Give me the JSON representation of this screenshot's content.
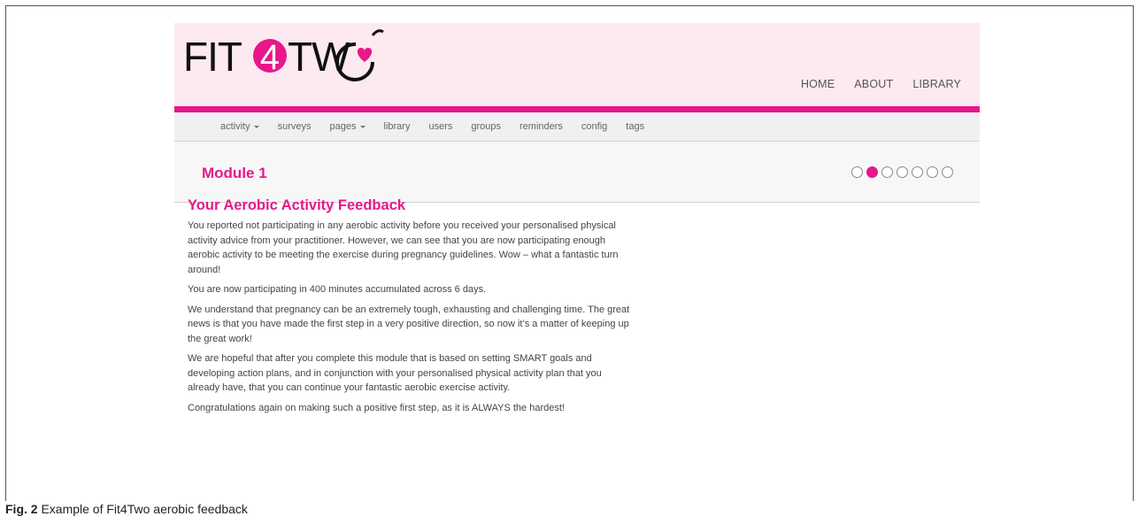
{
  "brand": {
    "logo_text": "FIT4TWO",
    "accent_color": "#e8178a"
  },
  "top_nav": [
    "HOME",
    "ABOUT",
    "LIBRARY"
  ],
  "admin_nav": [
    {
      "label": "activity",
      "dropdown": true
    },
    {
      "label": "surveys",
      "dropdown": false
    },
    {
      "label": "pages",
      "dropdown": true
    },
    {
      "label": "library",
      "dropdown": false
    },
    {
      "label": "users",
      "dropdown": false
    },
    {
      "label": "groups",
      "dropdown": false
    },
    {
      "label": "reminders",
      "dropdown": false
    },
    {
      "label": "config",
      "dropdown": false
    },
    {
      "label": "tags",
      "dropdown": false
    }
  ],
  "module": {
    "title": "Module 1",
    "progress": {
      "total": 7,
      "current": 2
    }
  },
  "feedback": {
    "heading": "Your Aerobic Activity Feedback",
    "paragraphs": [
      "You reported not participating in any aerobic activity before you received your personalised physical activity advice from your practitioner. However, we can see that you are now participating enough aerobic activity to be meeting the exercise during pregnancy guidelines. Wow – what a fantastic turn around!",
      "You are now participating in 400 minutes accumulated across 6 days.",
      "We understand that pregnancy can be an extremely tough, exhausting and challenging time. The great news is that you have made the first step in a very positive direction, so now it’s a matter of keeping up the great work!",
      "We are hopeful that after you complete this module that is based on setting SMART goals and developing action plans, and in conjunction with your personalised physical activity plan that you already have, that you can continue your fantastic aerobic exercise activity.",
      "Congratulations again on making such a positive first step, as it is ALWAYS the hardest!"
    ]
  },
  "caption": {
    "label": "Fig. 2",
    "text": "Example of Fit4Two aerobic feedback"
  }
}
